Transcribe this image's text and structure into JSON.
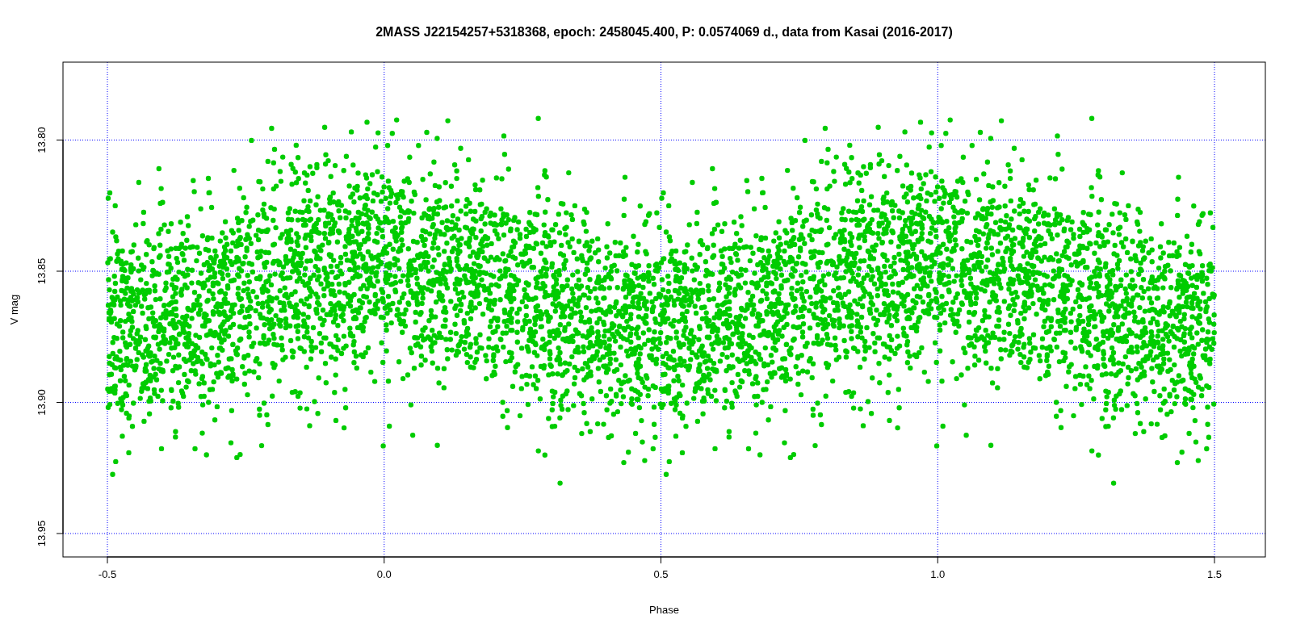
{
  "plot": {
    "title": "2MASS J22154257+5318368, epoch: 2458045.400, P: 0.0574069 d., data from Kasai (2016-2017)",
    "x_axis_label": "Phase",
    "y_axis_label": "V mag",
    "x_tick_labels": [
      "-0.5",
      "0.0",
      "0.5",
      "1.0",
      "1.5"
    ],
    "y_tick_labels": [
      "13.80",
      "13.85",
      "13.90",
      "13.95"
    ],
    "grid": true
  }
}
